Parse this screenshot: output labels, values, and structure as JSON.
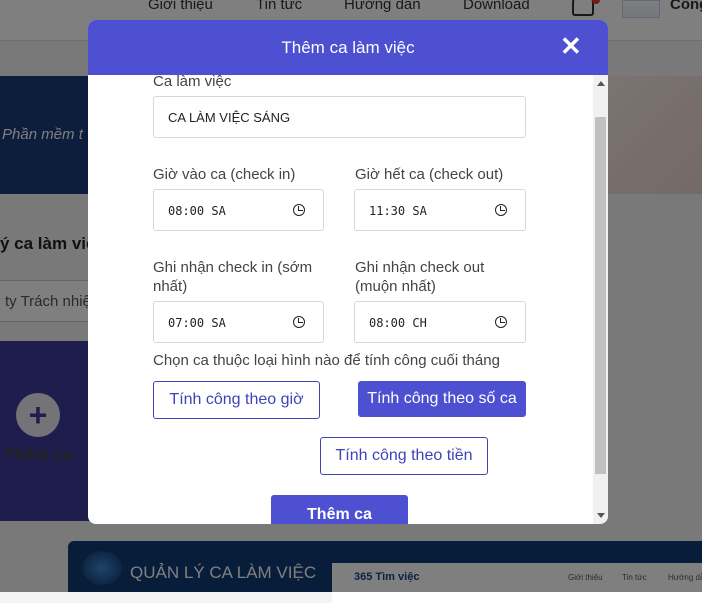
{
  "background": {
    "nav": [
      "Giới thiệu",
      "Tin tức",
      "Hướng dẫn",
      "Download"
    ],
    "nav_right": "Công",
    "hero_text": "Phần mềm t",
    "section_title": "ý ca làm việ",
    "search_placeholder": "ty Trách nhiệ",
    "add_card_label": "Thêm ca",
    "banner_title": "QUẢN LÝ CA LÀM VIỆC",
    "banner_brand": "365 Tìm việc",
    "banner_nav": [
      "Giới thiệu",
      "Tin tức",
      "Hướng dẫ"
    ]
  },
  "modal": {
    "title": "Thêm ca làm việc",
    "close_symbol": "✕",
    "shift_label": "Ca làm việc",
    "shift_value": "CA LÀM VIỆC SÁNG",
    "checkin_label": "Giờ vào ca (check in)",
    "checkin_value": "08:00 SA",
    "checkout_label": "Giờ hết ca (check out)",
    "checkout_value": "11:30 SA",
    "early_label_1": "Ghi nhận check in (sớm",
    "early_label_2": "nhất)",
    "early_value": "07:00 SA",
    "late_label_1": "Ghi nhận check out",
    "late_label_2": "(muộn nhất)",
    "late_value": "08:00 CH",
    "type_question": "Chọn ca thuộc loại hình nào để tính công cuối tháng",
    "type_options": [
      "Tính công theo giờ",
      "Tính công theo số ca",
      "Tính công theo tiền"
    ],
    "selected_option": "Tính công theo số ca",
    "submit_label": "Thêm ca"
  },
  "colors": {
    "accent": "#4c50d1",
    "overlay": "rgba(0,0,0,0.5)"
  }
}
